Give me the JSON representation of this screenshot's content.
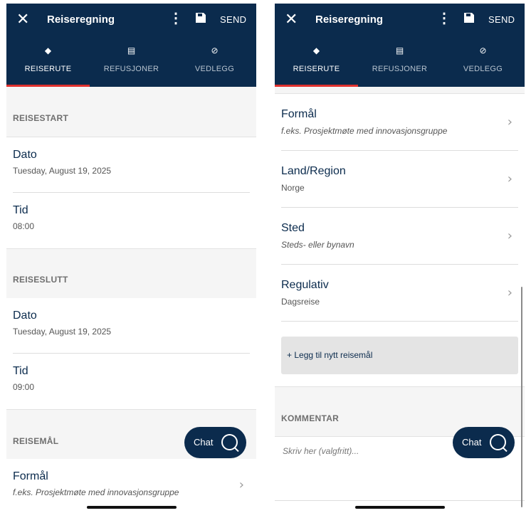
{
  "appbar": {
    "title": "Reiseregning",
    "send_label": "SEND",
    "close_glyph": "✕",
    "more_glyph": "⋮"
  },
  "tabs": [
    {
      "label": "REISERUTE",
      "icon": "route-icon",
      "glyph": "◆",
      "active": true
    },
    {
      "label": "REFUSJONER",
      "icon": "receipt-icon",
      "glyph": "▤",
      "active": false
    },
    {
      "label": "VEDLEGG",
      "icon": "paperclip-icon",
      "glyph": "⊘",
      "active": false
    }
  ],
  "left": {
    "reisestart": {
      "title": "REISESTART",
      "dato_label": "Dato",
      "dato_value": "Tuesday, August 19, 2025",
      "tid_label": "Tid",
      "tid_value": "08:00"
    },
    "reiseslutt": {
      "title": "REISESLUTT",
      "dato_label": "Dato",
      "dato_value": "Tuesday, August 19, 2025",
      "tid_label": "Tid",
      "tid_value": "09:00"
    },
    "reisemal": {
      "title": "REISEMÅL",
      "formal_label": "Formål",
      "formal_placeholder": "f.eks. Prosjektmøte med innovasjonsgruppe"
    }
  },
  "right": {
    "formal_label": "Formål",
    "formal_placeholder": "f.eks. Prosjektmøte med innovasjonsgruppe",
    "land_label": "Land/Region",
    "land_value": "Norge",
    "sted_label": "Sted",
    "sted_placeholder": "Steds- eller bynavn",
    "regulativ_label": "Regulativ",
    "regulativ_value": "Dagsreise",
    "add_button": "+ Legg til nytt reisemål",
    "kommentar_title": "KOMMENTAR",
    "kommentar_placeholder": "Skriv her (valgfritt)..."
  },
  "chat": {
    "label": "Chat"
  },
  "chevron": "›",
  "colors": {
    "header_bg": "#0b2b4d",
    "active_tab_indicator": "#e0312e",
    "section_bg": "#f5f5f5"
  }
}
